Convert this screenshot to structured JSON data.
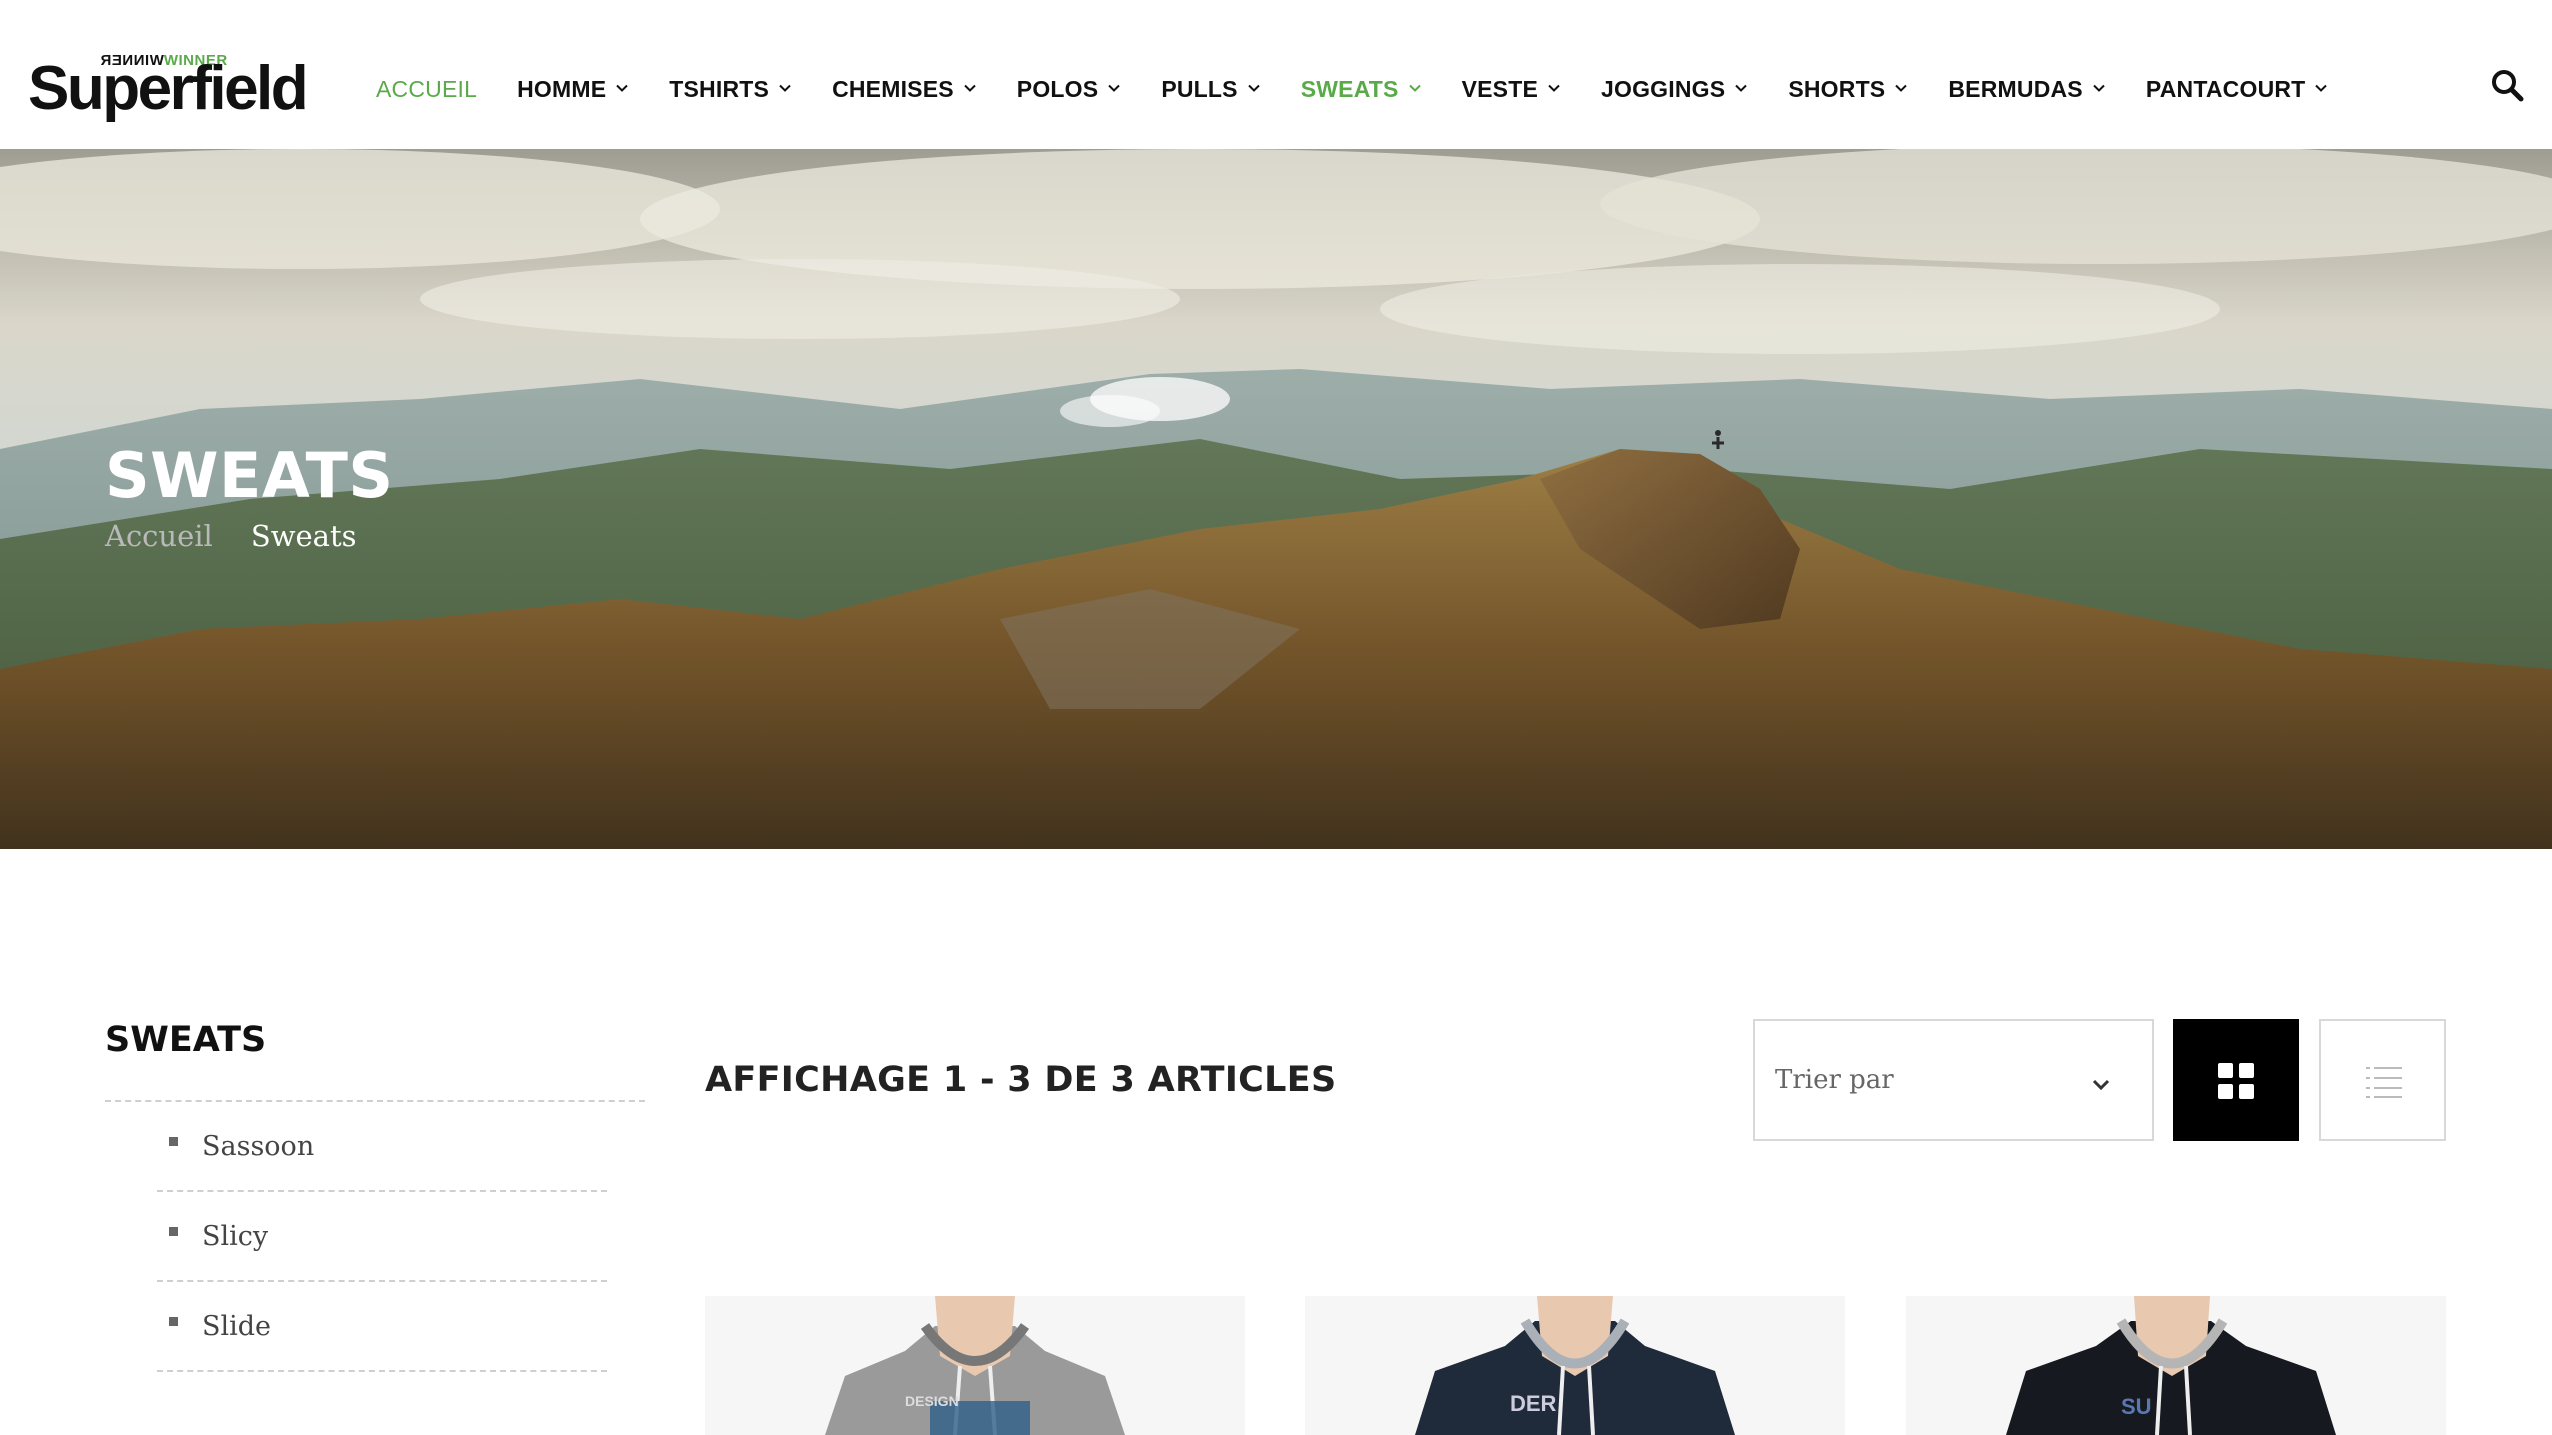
{
  "header": {
    "logo_small_reversed": "WINNER",
    "logo_small_green": "WINNER",
    "logo_main": "Superfield",
    "nav": [
      {
        "label": "ACCUEIL",
        "has_menu": false,
        "active": true
      },
      {
        "label": "HOMME",
        "has_menu": true
      },
      {
        "label": "TSHIRTS",
        "has_menu": true
      },
      {
        "label": "CHEMISES",
        "has_menu": true
      },
      {
        "label": "POLOS",
        "has_menu": true
      },
      {
        "label": "PULLS",
        "has_menu": true
      },
      {
        "label": "SWEATS",
        "has_menu": true,
        "current": true
      },
      {
        "label": "VESTE",
        "has_menu": true
      },
      {
        "label": "JOGGINGS",
        "has_menu": true
      },
      {
        "label": "SHORTS",
        "has_menu": true
      },
      {
        "label": "BERMUDAS",
        "has_menu": true
      },
      {
        "label": "PANTACOURT",
        "has_menu": true
      }
    ],
    "search_icon": "search-icon"
  },
  "hero": {
    "title": "SWEATS",
    "breadcrumb": {
      "home": "Accueil",
      "current": "Sweats"
    }
  },
  "sidebar": {
    "title": "SWEATS",
    "categories": [
      "Sassoon",
      "Slicy",
      "Slide"
    ]
  },
  "main": {
    "count_title": "AFFICHAGE 1 - 3 DE 3 ARTICLES",
    "sort_placeholder": "Trier par",
    "view_grid_icon": "grid-view-icon",
    "view_list_icon": "list-view-icon",
    "products": [
      {
        "color": "grey hoodie"
      },
      {
        "color": "navy hoodie"
      },
      {
        "color": "black hoodie"
      }
    ]
  },
  "colors": {
    "accent": "#5aaa4a",
    "text": "#111111",
    "muted": "#666666",
    "border": "#d8d8d8"
  }
}
